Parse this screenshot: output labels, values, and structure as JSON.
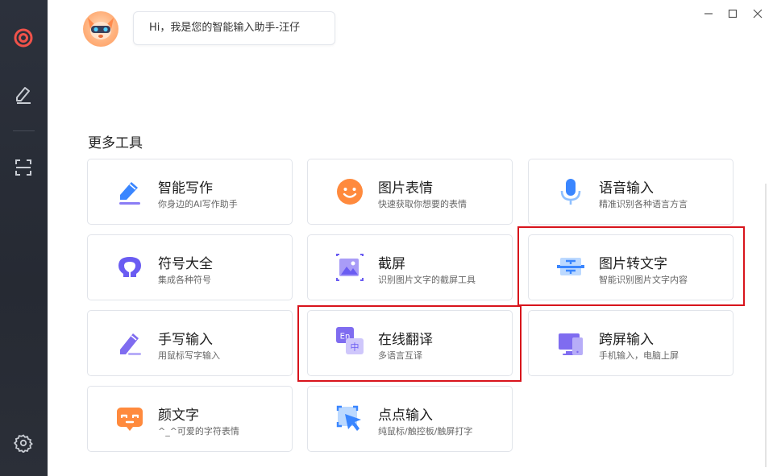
{
  "assistant": {
    "greeting": "Hi，我是您的智能输入助手-汪仔"
  },
  "section": {
    "title": "更多工具"
  },
  "tools": [
    {
      "title": "智能写作",
      "subtitle": "你身边的AI写作助手"
    },
    {
      "title": "图片表情",
      "subtitle": "快速获取你想要的表情"
    },
    {
      "title": "语音输入",
      "subtitle": "精准识别各种语言方言"
    },
    {
      "title": "符号大全",
      "subtitle": "集成各种符号"
    },
    {
      "title": "截屏",
      "subtitle": "识别图片文字的截屏工具"
    },
    {
      "title": "图片转文字",
      "subtitle": "智能识别图片文字内容"
    },
    {
      "title": "手写输入",
      "subtitle": "用鼠标写字输入"
    },
    {
      "title": "在线翻译",
      "subtitle": "多语言互译"
    },
    {
      "title": "跨屏输入",
      "subtitle": "手机输入，电脑上屏"
    },
    {
      "title": "颜文字",
      "subtitle": "^_^可爱的字符表情"
    },
    {
      "title": "点点输入",
      "subtitle": "纯鼠标/触控板/触屏打字"
    }
  ],
  "translate_icon": {
    "en": "En",
    "zh": "中"
  },
  "colors": {
    "sidebar_bg": "#2b2f38",
    "accent_red": "#e6463f",
    "highlight_box": "#d8141c",
    "icon_blue": "#3a86ff",
    "icon_purple": "#7f6cf0",
    "icon_orange": "#ff8a3d"
  },
  "icons": [
    "logo-ring-icon",
    "pen-sidebar-icon",
    "scan-icon",
    "settings-icon",
    "minimize-icon",
    "maximize-icon",
    "close-icon"
  ]
}
